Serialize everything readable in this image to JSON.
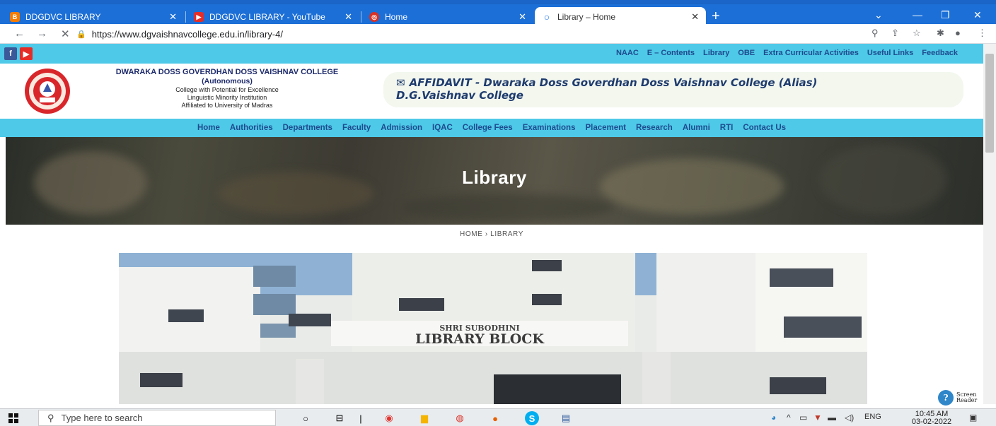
{
  "browser": {
    "tabs": [
      {
        "title": "DDGDVC LIBRARY",
        "favicon_color": "#f57c00",
        "favicon_glyph": "B"
      },
      {
        "title": "DDGDVC LIBRARY - YouTube",
        "favicon_color": "#e52d27",
        "favicon_glyph": "▶"
      },
      {
        "title": "Home",
        "favicon_color": "#d93025",
        "favicon_glyph": "◎"
      },
      {
        "title": "Library – Home",
        "favicon_color": "#1a73e8",
        "favicon_glyph": "○"
      }
    ],
    "url": "https://www.dgvaishnavcollege.edu.in/library-4/"
  },
  "site": {
    "top_links": [
      "NAAC",
      "E – Contents",
      "Library",
      "OBE",
      "Extra Curricular Activities",
      "Useful Links",
      "Feedback"
    ],
    "college": {
      "name": "DWARAKA DOSS GOVERDHAN DOSS VAISHNAV COLLEGE",
      "autonomous": "(Autonomous)",
      "line1": "College with Potential for Excellence",
      "line2": "Linguistic Minority Institution",
      "line3": "Affiliated to University of Madras"
    },
    "affidavit_line1": "AFFIDAVIT - Dwaraka Doss Goverdhan Doss Vaishnav College (Alias)",
    "affidavit_line2": "D.G.Vaishnav College",
    "nav": [
      "Home",
      "Authorities",
      "Departments",
      "Faculty",
      "Admission",
      "IQAC",
      "College Fees",
      "Examinations",
      "Placement",
      "Research",
      "Alumni",
      "RTI",
      "Contact Us"
    ],
    "banner_title": "Library",
    "breadcrumb": {
      "home": "HOME",
      "sep": "›",
      "current": "LIBRARY"
    },
    "photo_sign": {
      "line1": "SHRI SUBODHINI",
      "line2": "LIBRARY BLOCK"
    }
  },
  "taskbar": {
    "search_placeholder": "Type here to search",
    "language": "ENG",
    "time": "10:45 AM",
    "date": "03-02-2022",
    "screen_reader_line1": "Screen",
    "screen_reader_line2": "Reader"
  },
  "colors": {
    "tabstrip": "#1c6fd6",
    "site_accent": "#4ec9e8",
    "nav_text": "#1e4b8e"
  }
}
